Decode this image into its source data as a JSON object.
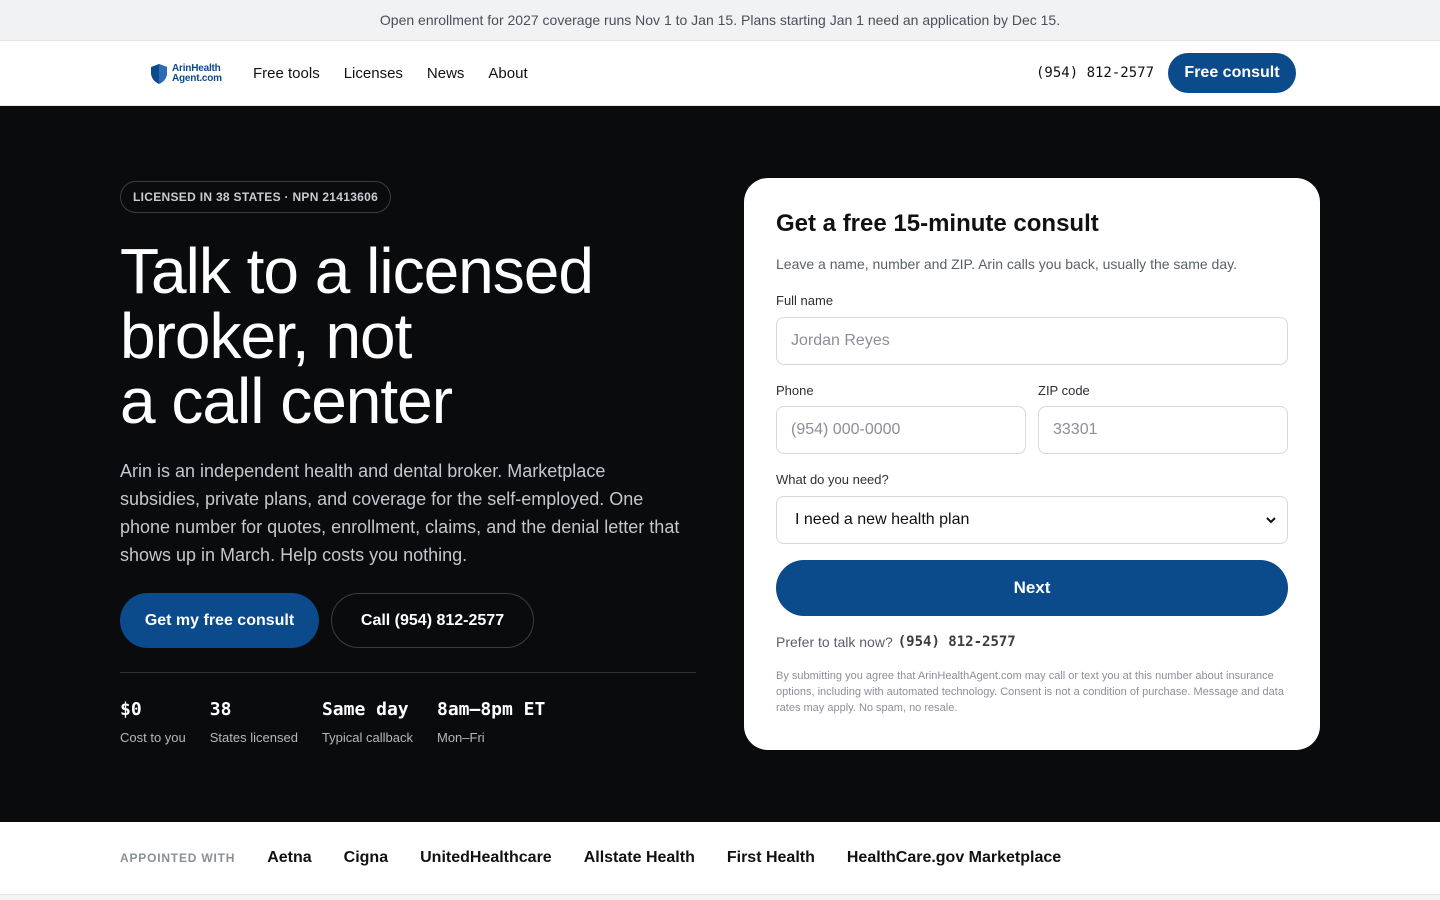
{
  "announcement": "Open enrollment for 2027 coverage runs Nov 1 to Jan 15. Plans starting Jan 1 need an application by Dec 15.",
  "nav": {
    "logo_line1": "ArinHealth",
    "logo_line2": "Agent.com",
    "links": [
      "Free tools",
      "Licenses",
      "News",
      "About"
    ],
    "phone": "(954) 812-2577",
    "cta": "Free consult"
  },
  "hero": {
    "badge": "LICENSED IN 38 STATES · NPN 21413606",
    "headline_line1": "Talk to a licensed",
    "headline_line2": "broker, not",
    "headline_line3": "a call center",
    "lede": "Arin is an independent health and dental broker. Marketplace subsidies, private plans, and coverage for the self-employed. One phone number for quotes, enrollment, claims, and the denial letter that shows up in March. Help costs you nothing.",
    "primary_cta": "Get my free consult",
    "secondary_cta": "Call (954) 812-2577",
    "stats": [
      {
        "value": "$0",
        "label": "Cost to you"
      },
      {
        "value": "38",
        "label": "States licensed"
      },
      {
        "value": "Same day",
        "label": "Typical callback"
      },
      {
        "value": "8am–8pm ET",
        "label": "Mon–Fri"
      }
    ]
  },
  "form": {
    "title": "Get a free 15-minute consult",
    "subtitle": "Leave a name, number and ZIP. Arin calls you back, usually the same day.",
    "name_label": "Full name",
    "name_placeholder": "Jordan Reyes",
    "phone_label": "Phone",
    "phone_placeholder": "(954) 000-0000",
    "zip_label": "ZIP code",
    "zip_placeholder": "33301",
    "need_label": "What do you need?",
    "need_selected": "I need a new health plan",
    "submit": "Next",
    "prefer_text": "Prefer to talk now?",
    "prefer_phone": "(954) 812-2577",
    "legal": "By submitting you agree that ArinHealthAgent.com may call or text you at this number about insurance options, including with automated technology. Consent is not a condition of purchase. Message and data rates may apply. No spam, no resale."
  },
  "carriers": {
    "label": "APPOINTED WITH",
    "names": [
      "Aetna",
      "Cigna",
      "UnitedHealthcare",
      "Allstate Health",
      "First Health",
      "HealthCare.gov Marketplace"
    ]
  },
  "colors": {
    "brand": "#0b4a8b",
    "hero_bg": "#0a0b0d"
  }
}
